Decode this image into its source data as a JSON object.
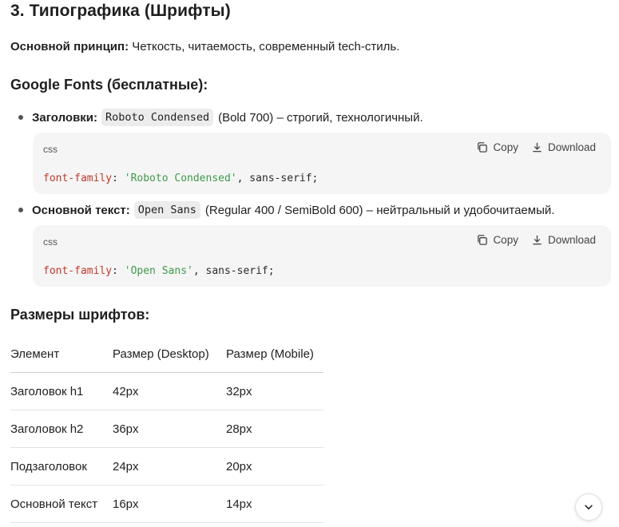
{
  "section": {
    "title": "3. Типографика (Шрифты)",
    "principle_label": "Основной принцип:",
    "principle_text": "Четкость, читаемость, современный tech-стиль."
  },
  "google_fonts": {
    "title": "Google Fonts (бесплатные):",
    "items": [
      {
        "label": "Заголовки:",
        "code": "Roboto Condensed",
        "desc": "(Bold 700) – строгий, технологичный.",
        "block": {
          "lang": "css",
          "copy": "Copy",
          "download": "Download",
          "prop": "font-family",
          "colon": ": ",
          "str": "'Roboto Condensed'",
          "rest": ", sans-serif;"
        }
      },
      {
        "label": "Основной текст:",
        "code": "Open Sans",
        "desc": "(Regular 400 / SemiBold 600) – нейтральный и удобочитаемый.",
        "block": {
          "lang": "css",
          "copy": "Copy",
          "download": "Download",
          "prop": "font-family",
          "colon": ": ",
          "str": "'Open Sans'",
          "rest": ", sans-serif;"
        }
      }
    ]
  },
  "sizes": {
    "title": "Размеры шрифтов:",
    "headers": [
      "Элемент",
      "Размер (Desktop)",
      "Размер (Mobile)"
    ],
    "rows": [
      [
        "Заголовок h1",
        "42px",
        "32px"
      ],
      [
        "Заголовок h2",
        "36px",
        "28px"
      ],
      [
        "Подзаголовок",
        "24px",
        "20px"
      ],
      [
        "Основной текст",
        "16px",
        "14px"
      ]
    ]
  },
  "icons": {
    "copy": "copy-icon",
    "download": "download-icon",
    "scroll": "chevron-down-icon"
  },
  "colors": {
    "code_property": "#c0392b",
    "code_string": "#3f9a4a",
    "code_bg": "#f5f5f5"
  }
}
